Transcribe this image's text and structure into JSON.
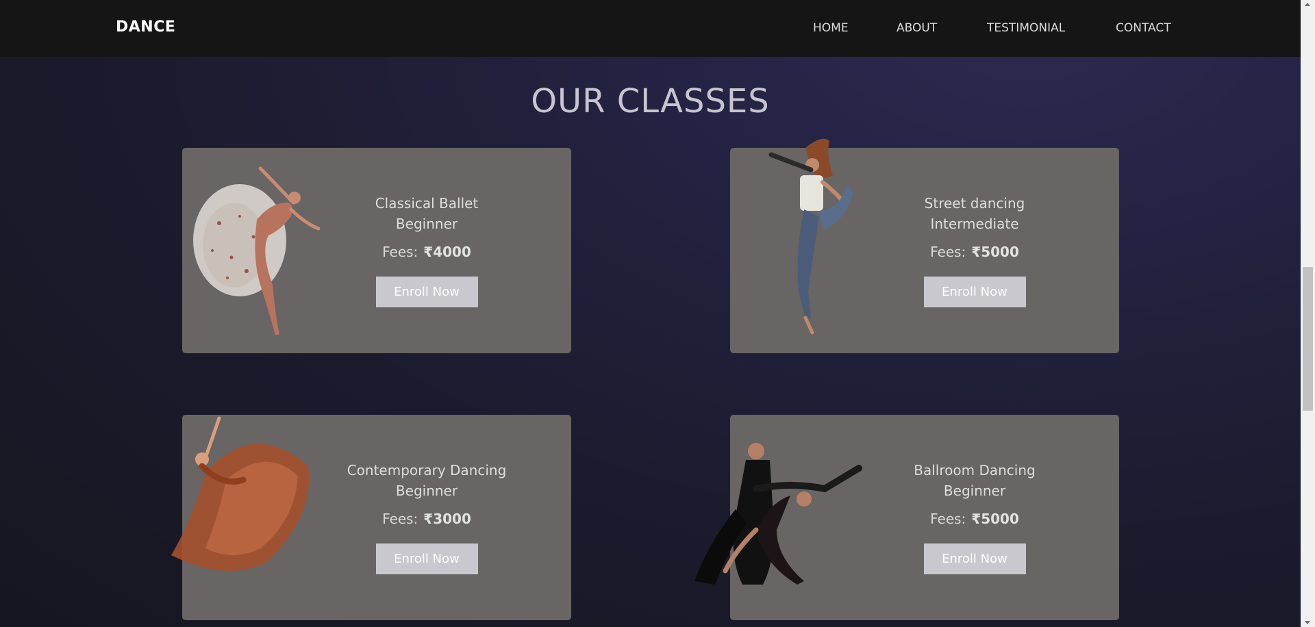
{
  "nav": {
    "logo": "DANCE",
    "links": [
      "HOME",
      "ABOUT",
      "TESTIMONIAL",
      "CONTACT"
    ]
  },
  "section": {
    "title": "OUR CLASSES"
  },
  "classes": [
    {
      "name": "Classical Ballet",
      "level": "Beginner",
      "fees_label": "Fees:",
      "fees": "₹4000",
      "button": "Enroll Now",
      "image_icon": "ballet-dancer-image"
    },
    {
      "name": "Street dancing",
      "level": "Intermediate",
      "fees_label": "Fees:",
      "fees": "₹5000",
      "button": "Enroll Now",
      "image_icon": "street-dancer-image"
    },
    {
      "name": "Contemporary Dancing",
      "level": "Beginner",
      "fees_label": "Fees:",
      "fees": "₹3000",
      "button": "Enroll Now",
      "image_icon": "contemporary-dancer-image"
    },
    {
      "name": "Ballroom Dancing",
      "level": "Beginner",
      "fees_label": "Fees:",
      "fees": "₹5000",
      "button": "Enroll Now",
      "image_icon": "ballroom-dancers-image"
    }
  ],
  "colors": {
    "navbar": "#151515",
    "card": "#686564",
    "button": "#c9c8cf",
    "title": "#c8c4d0"
  }
}
